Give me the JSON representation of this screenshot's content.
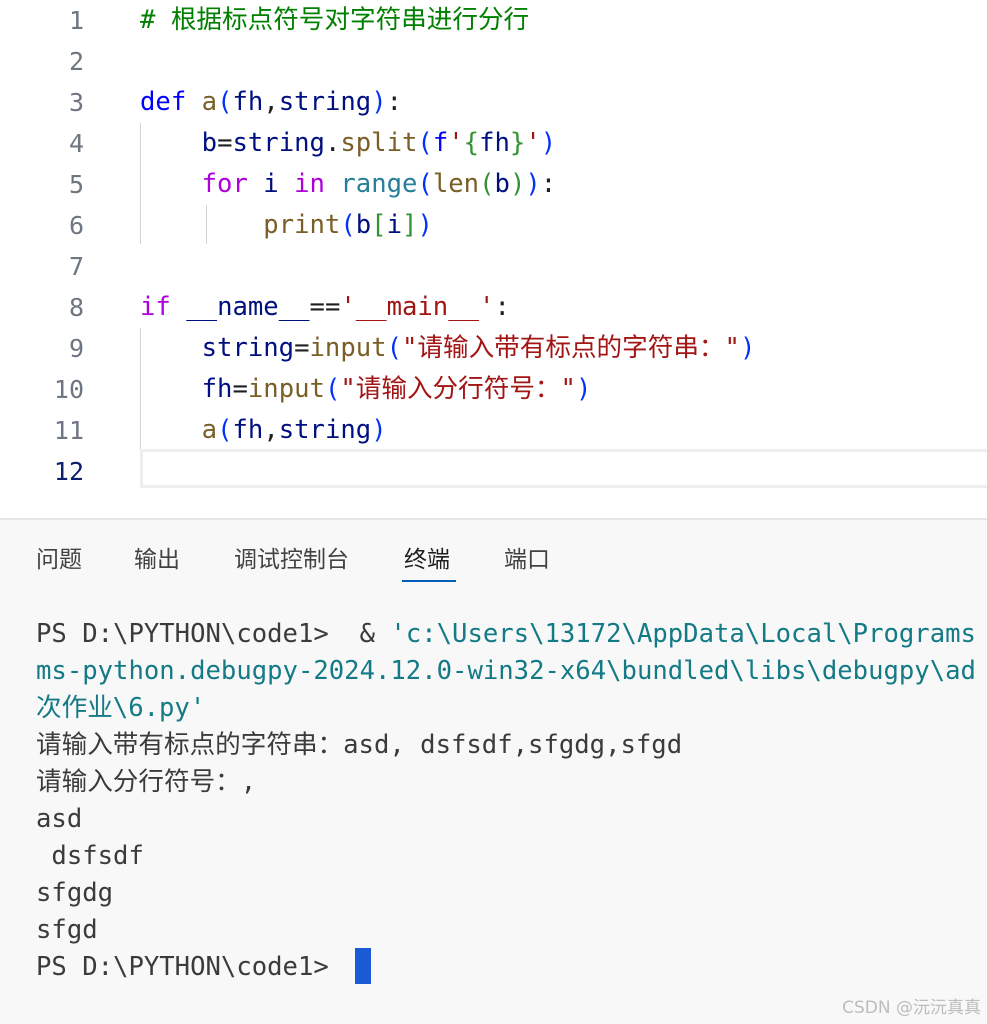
{
  "editor": {
    "line_numbers": [
      "1",
      "2",
      "3",
      "4",
      "5",
      "6",
      "7",
      "8",
      "9",
      "10",
      "11",
      "12"
    ],
    "lines": [
      [
        [
          "c-com",
          "# 根据标点符号对字符串进行分行"
        ]
      ],
      [],
      [
        [
          "c-kw",
          "def"
        ],
        [
          "c-pn",
          " "
        ],
        [
          "c-fn",
          "a"
        ],
        [
          "b1",
          "("
        ],
        [
          "c-var",
          "fh"
        ],
        [
          "c-pn",
          ","
        ],
        [
          "c-var",
          "string"
        ],
        [
          "b1",
          ")"
        ],
        [
          "c-pn",
          ":"
        ]
      ],
      [
        [
          "c-pn",
          "    "
        ],
        [
          "c-var",
          "b"
        ],
        [
          "c-pn",
          "="
        ],
        [
          "c-var",
          "string"
        ],
        [
          "c-pn",
          "."
        ],
        [
          "c-fn",
          "split"
        ],
        [
          "b1",
          "("
        ],
        [
          "c-kw",
          "f"
        ],
        [
          "c-str",
          "'"
        ],
        [
          "b2",
          "{"
        ],
        [
          "c-var",
          "fh"
        ],
        [
          "b2",
          "}"
        ],
        [
          "c-str",
          "'"
        ],
        [
          "b1",
          ")"
        ]
      ],
      [
        [
          "c-pn",
          "    "
        ],
        [
          "c-ctl",
          "for"
        ],
        [
          "c-pn",
          " "
        ],
        [
          "c-var",
          "i"
        ],
        [
          "c-pn",
          " "
        ],
        [
          "c-ctl",
          "in"
        ],
        [
          "c-pn",
          " "
        ],
        [
          "c-cls",
          "range"
        ],
        [
          "b1",
          "("
        ],
        [
          "c-fn",
          "len"
        ],
        [
          "b2",
          "("
        ],
        [
          "c-var",
          "b"
        ],
        [
          "b2",
          ")"
        ],
        [
          "b1",
          ")"
        ],
        [
          "c-pn",
          ":"
        ]
      ],
      [
        [
          "c-pn",
          "        "
        ],
        [
          "c-fn",
          "print"
        ],
        [
          "b1",
          "("
        ],
        [
          "c-var",
          "b"
        ],
        [
          "b2",
          "["
        ],
        [
          "c-var",
          "i"
        ],
        [
          "b2",
          "]"
        ],
        [
          "b1",
          ")"
        ]
      ],
      [],
      [
        [
          "c-ctl",
          "if"
        ],
        [
          "c-pn",
          " "
        ],
        [
          "c-var",
          "__name__"
        ],
        [
          "c-pn",
          "=="
        ],
        [
          "c-str",
          "'__main__'"
        ],
        [
          "c-pn",
          ":"
        ]
      ],
      [
        [
          "c-pn",
          "    "
        ],
        [
          "c-var",
          "string"
        ],
        [
          "c-pn",
          "="
        ],
        [
          "c-fn",
          "input"
        ],
        [
          "b1",
          "("
        ],
        [
          "c-str",
          "\"请输入带有标点的字符串：\""
        ],
        [
          "b1",
          ")"
        ]
      ],
      [
        [
          "c-pn",
          "    "
        ],
        [
          "c-var",
          "fh"
        ],
        [
          "c-pn",
          "="
        ],
        [
          "c-fn",
          "input"
        ],
        [
          "b1",
          "("
        ],
        [
          "c-str",
          "\"请输入分行符号：\""
        ],
        [
          "b1",
          ")"
        ]
      ],
      [
        [
          "c-pn",
          "    "
        ],
        [
          "c-fn",
          "a"
        ],
        [
          "b1",
          "("
        ],
        [
          "c-var",
          "fh"
        ],
        [
          "c-pn",
          ","
        ],
        [
          "c-var",
          "string"
        ],
        [
          "b1",
          ")"
        ]
      ],
      []
    ],
    "active_line": 12
  },
  "panel": {
    "tabs": [
      "问题",
      "输出",
      "调试控制台",
      "终端",
      "端口"
    ],
    "active_tab": "终端"
  },
  "terminal": {
    "lines": [
      [
        [
          "",
          "PS D:\\PYTHON\\code1>  & "
        ],
        [
          "path",
          "'c:\\Users\\13172\\AppData\\Local\\Programs"
        ]
      ],
      [
        [
          "path",
          "ms-python.debugpy-2024.12.0-win32-x64\\bundled\\libs\\debugpy\\ad"
        ]
      ],
      [
        [
          "path",
          "次作业\\6.py'"
        ]
      ],
      [
        [
          "",
          "请输入带有标点的字符串：asd, dsfsdf,sfgdg,sfgd"
        ]
      ],
      [
        [
          "",
          "请输入分行符号：,"
        ]
      ],
      [
        [
          "",
          "asd"
        ]
      ],
      [
        [
          "",
          ""
        ],
        [
          "",
          ""
        ]
      ],
      [
        [
          "",
          "sfgdg"
        ]
      ],
      [
        [
          "",
          "sfgd"
        ]
      ],
      [
        [
          "",
          "PS D:\\PYTHON\\code1> "
        ]
      ]
    ],
    "line_dsfsdf": " dsfsdf"
  },
  "watermark": "CSDN @沅沅真真"
}
